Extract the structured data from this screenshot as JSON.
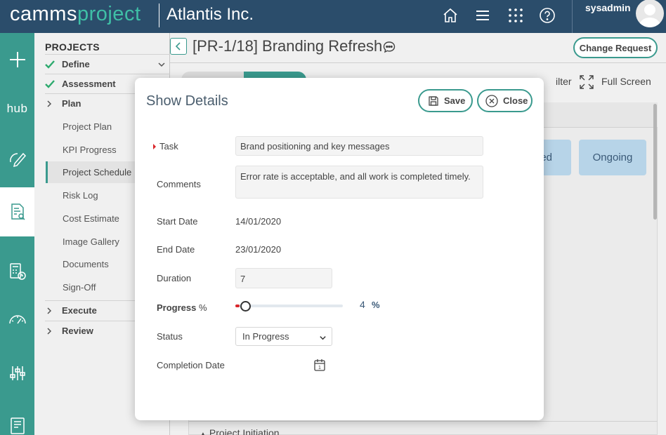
{
  "header": {
    "logo_part1": "camms",
    "logo_part2": "project",
    "company": "Atlantis Inc.",
    "username": "sysadmin",
    "icons": [
      "home-icon",
      "menu-icon",
      "apps-grid-icon",
      "help-icon"
    ]
  },
  "rail": {
    "hub_label": "hub",
    "icons": [
      "plus-icon",
      "hub-icon",
      "edit-icon",
      "document-search-icon",
      "calculator-clock-icon",
      "gauge-icon",
      "sliders-icon",
      "report-icon"
    ]
  },
  "projects_nav": {
    "title": "PROJECTS",
    "sections": [
      {
        "label": "Define",
        "status": "done"
      },
      {
        "label": "Assessment",
        "status": "done"
      },
      {
        "label": "Plan",
        "status": "expanded"
      }
    ],
    "plan_items": [
      "Project Plan",
      "KPI Progress",
      "Project Schedule",
      "Risk Log",
      "Cost Estimate",
      "Image Gallery",
      "Documents",
      "Sign-Off"
    ],
    "active_item": "Project Schedule",
    "more_sections": [
      "Execute",
      "Review"
    ]
  },
  "main": {
    "title": "[PR-1/18] Branding Refresh",
    "change_request_label": "Change Request",
    "filter_label": "ilter",
    "fullscreen_label": "Full Screen",
    "status_cards": [
      "ed",
      "Ongoing"
    ],
    "bottom_row": "Project Initiation"
  },
  "modal": {
    "title": "Show Details",
    "save_label": "Save",
    "close_label": "Close",
    "fields": {
      "task_label": "Task",
      "task_value": "Brand positioning and key messages",
      "comments_label": "Comments",
      "comments_value": "Error rate is acceptable, and all work is completed timely.",
      "start_label": "Start Date",
      "start_value": "14/01/2020",
      "end_label": "End Date",
      "end_value": "23/01/2020",
      "duration_label": "Duration",
      "duration_value": "7",
      "progress_label": "Progress",
      "progress_unit": "%",
      "progress_value": "4",
      "progress_percent": 4,
      "status_label": "Status",
      "status_value": "In Progress",
      "completion_label": "Completion Date",
      "completion_value": ""
    }
  },
  "colors": {
    "header_bg": "#2b4d6b",
    "accent": "#3a9a8e",
    "required": "#d9262a",
    "status_card": "#b7d4e8"
  }
}
